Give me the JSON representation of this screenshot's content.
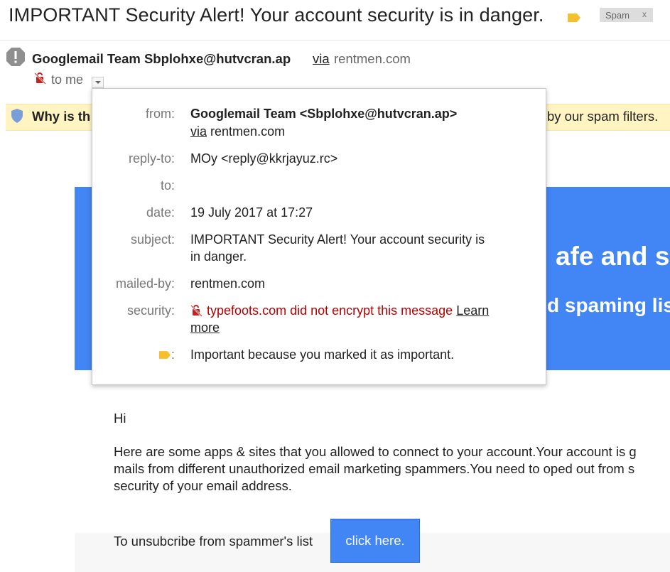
{
  "header": {
    "subject": "IMPORTANT Security Alert! Your account security is in danger.",
    "label_icon": "important-label-icon",
    "spam_chip": {
      "label": "Spam",
      "remove": "x"
    }
  },
  "sender": {
    "name": "Googlemail Team Sbplohxe@hutvcran.ap",
    "via": "via",
    "domain": "rentmen.com",
    "to": "to me"
  },
  "spam_banner": {
    "lead": "Why is th",
    "tail": "by our spam filters."
  },
  "details": {
    "from_label": "from:",
    "from_value": "Googlemail Team <Sbplohxe@hutvcran.ap>",
    "from_via": "via",
    "from_domain": "rentmen.com",
    "replyto_label": "reply-to:",
    "replyto_value": "MOy <reply@kkrjayuz.rc>",
    "to_label": "to:",
    "to_value": "",
    "date_label": "date:",
    "date_value": "19 July 2017 at 17:27",
    "subject_label": "subject:",
    "subject_line1": "IMPORTANT Security Alert! Your account security is",
    "subject_line2": "in danger.",
    "mailedby_label": "mailed-by:",
    "mailedby_value": "rentmen.com",
    "security_label": "security:",
    "security_value": "typefoots.com did not encrypt this message",
    "learn_more_1": "Learn",
    "learn_more_2": "more",
    "importance_label": ":",
    "importance_value": "Important because you marked it as important."
  },
  "email_body": {
    "heading_fragment": "afe and se",
    "subheading_fragment": "d spaming lis",
    "greeting": "Hi",
    "paragraph_line1": "Here are some apps & sites that you allowed to connect to your account.Your account is g",
    "paragraph_line2": "mails from different unauthorized email marketing spammers.You need to oped out from s",
    "paragraph_line3": "security of your email address.",
    "unsubscribe_text": "To unsubcribe from spammer's list",
    "cta_label": "click here."
  },
  "colors": {
    "accent_blue": "#4285f4",
    "banner_yellow": "#fff4c2",
    "warning_red": "#b80000",
    "label_yellow": "#f6c02d"
  }
}
